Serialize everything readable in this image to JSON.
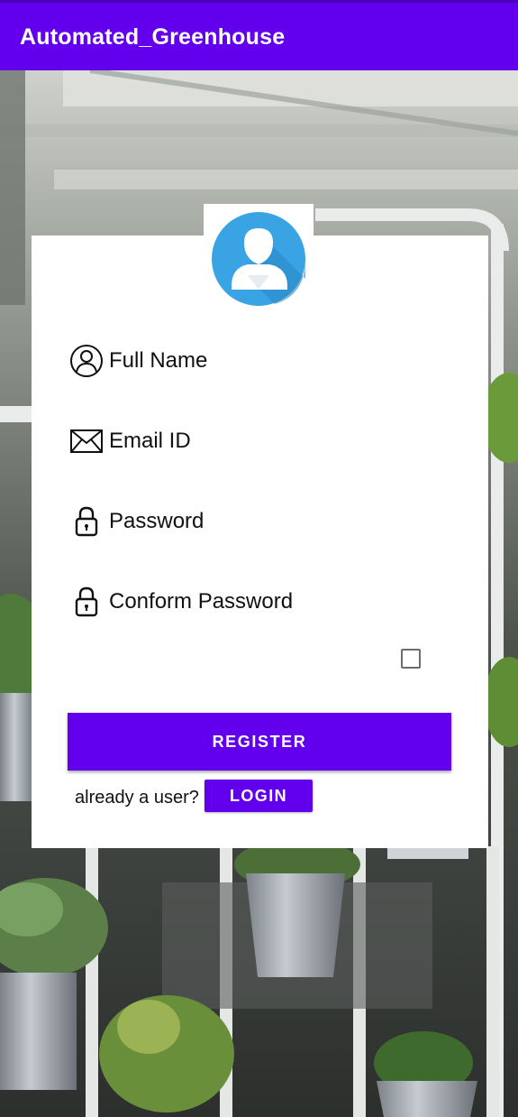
{
  "app_bar": {
    "title": "Automated_Greenhouse",
    "color": "#6200ee"
  },
  "background": {
    "description_icon": "greenhouse-photo"
  },
  "avatar": {
    "icon": "user-avatar-icon",
    "color": "#3aa3e3"
  },
  "form": {
    "full_name": {
      "placeholder": "Full Name",
      "icon": "person-circle-icon"
    },
    "email": {
      "placeholder": "Email ID",
      "icon": "envelope-icon"
    },
    "password": {
      "placeholder": "Password",
      "icon": "lock-icon"
    },
    "confirm_password": {
      "placeholder": "Conform Password",
      "icon": "lock-icon"
    },
    "show_password_checkbox": {
      "checked": false
    }
  },
  "actions": {
    "register_label": "REGISTER",
    "already_user_text": "already a user?",
    "login_label": "LOGIN",
    "accent": "#6200ee"
  }
}
